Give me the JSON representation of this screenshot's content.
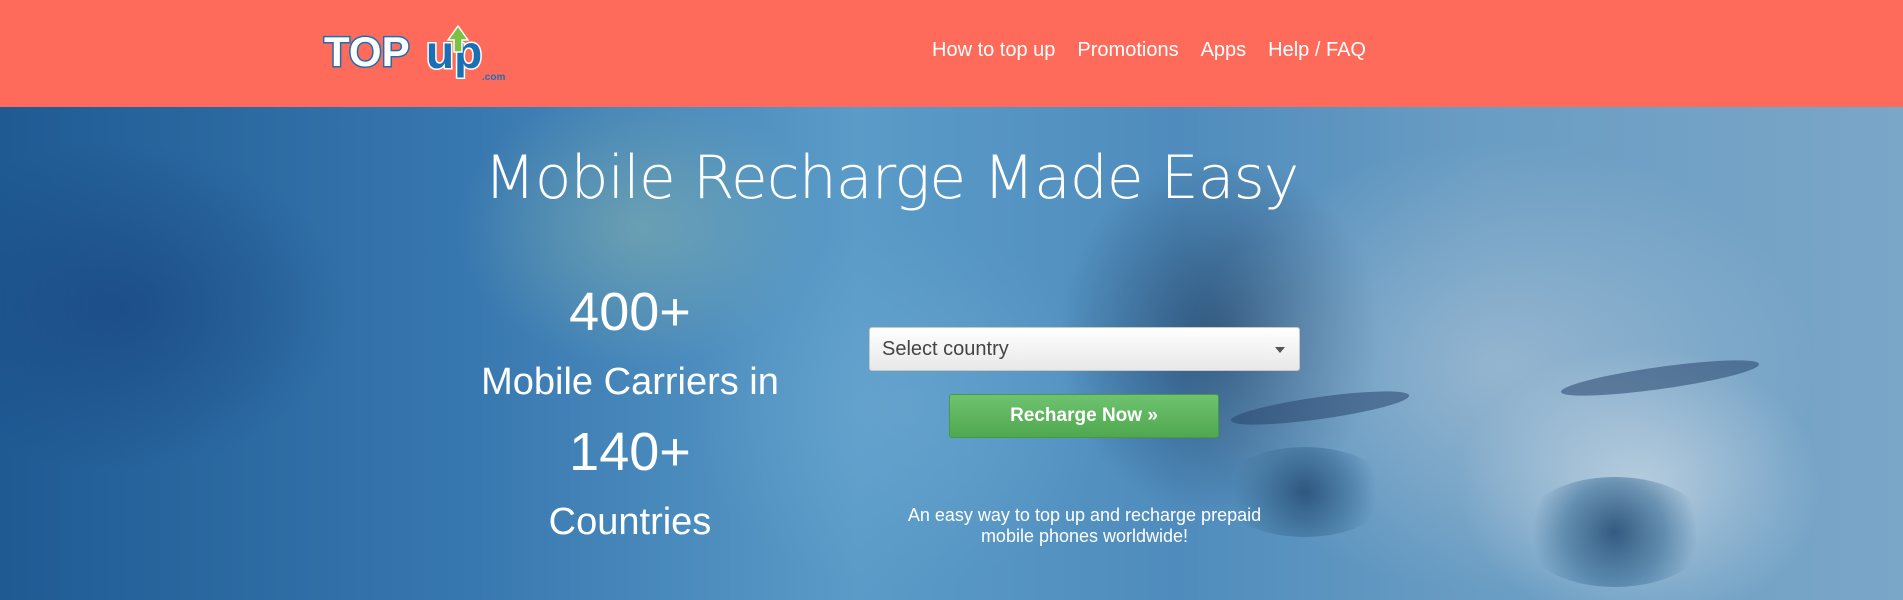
{
  "header": {
    "logo": {
      "text_main": "TOP",
      "text_up": "up",
      "text_suffix": ".com"
    },
    "nav": [
      {
        "label": "How to top up"
      },
      {
        "label": "Promotions"
      },
      {
        "label": "Apps"
      },
      {
        "label": "Help / FAQ"
      }
    ]
  },
  "hero": {
    "title": "Mobile Recharge Made Easy",
    "stats": {
      "carriers_count": "400+",
      "carriers_label": "Mobile Carriers in",
      "countries_count": "140+",
      "countries_label": "Countries"
    },
    "country_select": {
      "value": "Select country",
      "caret_icon": "triangle-down"
    },
    "recharge_button": "Recharge Now »",
    "tagline_line1": "An easy way to top up and recharge prepaid",
    "tagline_line2": "mobile phones worldwide!"
  },
  "colors": {
    "header_bg": "#ff6b5a",
    "button_green": "#5cb85c",
    "hero_blue": "#2a6aa3"
  }
}
